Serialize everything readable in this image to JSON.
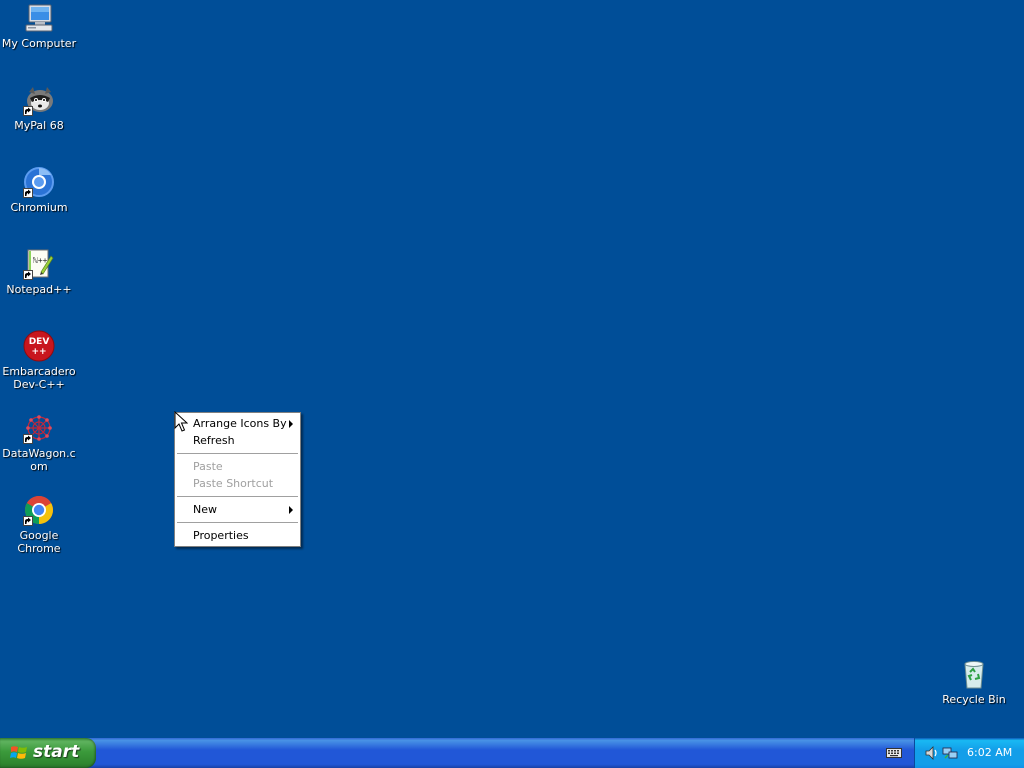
{
  "desktop": {
    "icons": [
      {
        "label": "My Computer",
        "icon": "my-computer-icon"
      },
      {
        "label": "MyPal 68",
        "icon": "mypal-icon"
      },
      {
        "label": "Chromium",
        "icon": "chromium-icon"
      },
      {
        "label": "Notepad++",
        "icon": "notepad-plus-plus-icon"
      },
      {
        "label": "Embarcadero Dev-C++",
        "icon": "devcpp-icon"
      },
      {
        "label": "DataWagon.com",
        "icon": "datawagon-icon"
      },
      {
        "label": "Google Chrome",
        "icon": "google-chrome-icon"
      },
      {
        "label": "Recycle Bin",
        "icon": "recycle-bin-icon"
      }
    ],
    "devcpp_badge": "DEV\n++",
    "background_color": "#004e98"
  },
  "context_menu": {
    "items": [
      {
        "label": "Arrange Icons By",
        "submenu": true,
        "enabled": true
      },
      {
        "label": "Refresh",
        "submenu": false,
        "enabled": true
      },
      {
        "label": "Paste",
        "submenu": false,
        "enabled": false
      },
      {
        "label": "Paste Shortcut",
        "submenu": false,
        "enabled": false
      },
      {
        "label": "New",
        "submenu": true,
        "enabled": true
      },
      {
        "label": "Properties",
        "submenu": false,
        "enabled": true
      }
    ]
  },
  "taskbar": {
    "start_label": "start",
    "clock": "6:02 AM",
    "tray_icons": [
      "keyboard-icon",
      "speaker-icon",
      "network-icon"
    ]
  }
}
